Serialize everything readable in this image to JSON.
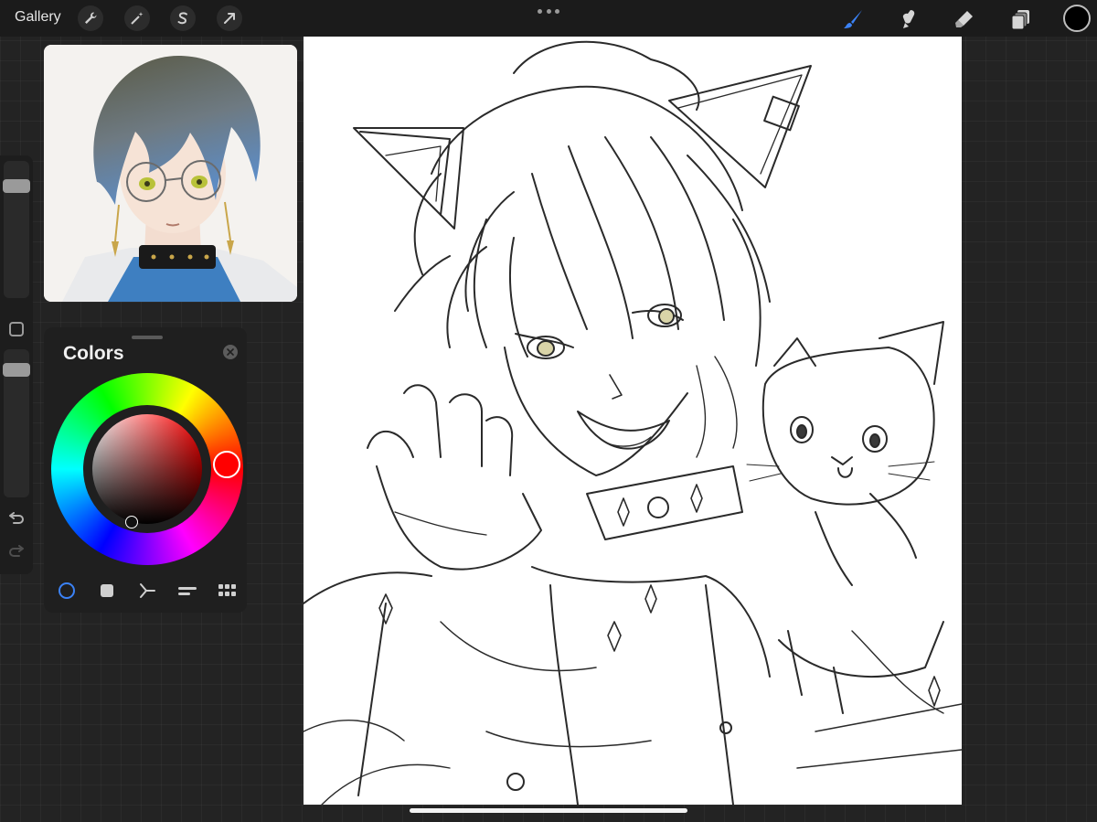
{
  "topbar": {
    "gallery_label": "Gallery",
    "left_tools": [
      {
        "name": "actions",
        "icon": "wrench-icon"
      },
      {
        "name": "adjustments",
        "icon": "magic-wand-icon"
      },
      {
        "name": "selection",
        "icon": "selection-s-icon"
      },
      {
        "name": "transform",
        "icon": "transform-arrow-icon"
      }
    ],
    "right_tools": [
      {
        "name": "brush",
        "icon": "brush-icon",
        "active": true
      },
      {
        "name": "smudge",
        "icon": "smudge-icon"
      },
      {
        "name": "eraser",
        "icon": "eraser-icon"
      },
      {
        "name": "layers",
        "icon": "layers-icon"
      }
    ],
    "current_color": "#000000",
    "accent_color": "#3b82f6"
  },
  "sidebar": {
    "brush_size_level": 0.85,
    "opacity_level": 0.9
  },
  "colors_panel": {
    "title": "Colors",
    "selected_hue": "#ff0000",
    "modes": [
      "disc",
      "classic",
      "harmony",
      "value",
      "palettes"
    ],
    "active_mode": "disc"
  }
}
